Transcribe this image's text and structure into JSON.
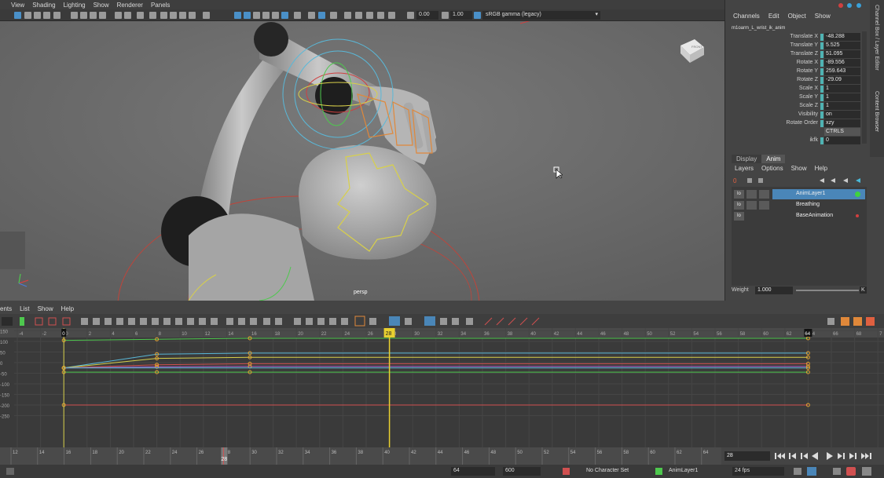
{
  "viewport": {
    "menu": [
      "View",
      "Shading",
      "Lighting",
      "Show",
      "Renderer",
      "Panels"
    ],
    "near_clip": "0.00",
    "far_clip": "1.00",
    "color_management": "sRGB gamma (legacy)",
    "camera_label": "persp",
    "view_cube_face": "FRONT"
  },
  "channel_box": {
    "menus": [
      "Channels",
      "Edit",
      "Object",
      "Show"
    ],
    "node_name": "m1oarm_L_wrist_ik_anim",
    "attributes": [
      {
        "label": "Translate X",
        "value": "-48.288"
      },
      {
        "label": "Translate Y",
        "value": "5.525"
      },
      {
        "label": "Translate Z",
        "value": "51.095"
      },
      {
        "label": "Rotate X",
        "value": "-89.556"
      },
      {
        "label": "Rotate Y",
        "value": "259.643"
      },
      {
        "label": "Rotate Z",
        "value": "-29.09"
      },
      {
        "label": "Scale X",
        "value": "1"
      },
      {
        "label": "Scale Y",
        "value": "1"
      },
      {
        "label": "Scale Z",
        "value": "1"
      },
      {
        "label": "Visibility",
        "value": "on"
      },
      {
        "label": "Rotate Order",
        "value": "xzy"
      },
      {
        "label": "",
        "value": "CTRLS"
      },
      {
        "label": "ikfk",
        "value": "0"
      }
    ],
    "side_tabs": [
      "Channel Box / Layer Editor",
      "Content Browser"
    ]
  },
  "layer_editor": {
    "tabs": [
      "Display",
      "Anim"
    ],
    "active_tab": "Anim",
    "menus": [
      "Layers",
      "Options",
      "Show",
      "Help"
    ],
    "layers": [
      {
        "name": "AnimLayer1",
        "selected": true,
        "indicator": "#3fd33f"
      },
      {
        "name": "Breathing",
        "selected": false,
        "indicator": ""
      },
      {
        "name": "BaseAnimation",
        "selected": false,
        "indicator": "#d33f3f"
      }
    ],
    "weight_label": "Weight",
    "weight_value": "1.000",
    "weight_end": "K"
  },
  "graph_editor": {
    "menus": [
      "ents",
      "List",
      "Show",
      "Help"
    ],
    "frame_ticks": [
      "-4",
      "-2",
      "0",
      "2",
      "4",
      "6",
      "8",
      "10",
      "12",
      "14",
      "16",
      "18",
      "20",
      "22",
      "24",
      "26",
      "28",
      "30",
      "32",
      "34",
      "36",
      "38",
      "40",
      "42",
      "44",
      "46",
      "48",
      "50",
      "52",
      "54",
      "56",
      "58",
      "60",
      "62",
      "64",
      "66",
      "68",
      "7"
    ],
    "value_ticks": [
      "150",
      "100",
      "50",
      "0",
      "-50",
      "-100",
      "-150",
      "-200",
      "-250"
    ],
    "current_frame": "28",
    "start_marker": "0",
    "end_marker": "64"
  },
  "time_slider": {
    "ticks": [
      "12",
      "14",
      "16",
      "18",
      "20",
      "22",
      "24",
      "26",
      "28",
      "30",
      "32",
      "34",
      "36",
      "38",
      "40",
      "42",
      "44",
      "46",
      "48",
      "50",
      "52",
      "54",
      "56",
      "58",
      "60",
      "62",
      "64"
    ],
    "current_frame": "28",
    "current_frame_field": "28"
  },
  "range_bar": {
    "start": "64",
    "end": "600",
    "character_set": "No Character Set",
    "anim_layer": "AnimLayer1",
    "fps": "24 fps"
  },
  "playback_icons": [
    "go-to-start-icon",
    "step-back-key-icon",
    "step-back-frame-icon",
    "play-backward-icon",
    "play-forward-icon",
    "step-forward-frame-icon",
    "step-forward-key-icon",
    "go-to-end-icon"
  ]
}
